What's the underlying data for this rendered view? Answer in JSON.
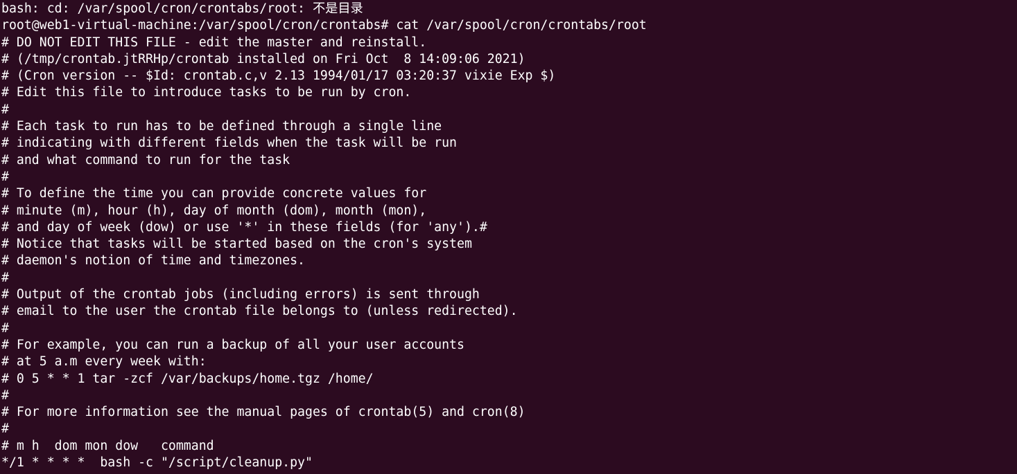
{
  "terminal": {
    "colors": {
      "background": "#2c0b20",
      "text": "#ffffff"
    },
    "lines": [
      "bash: cd: /var/spool/cron/crontabs/root: 不是目录",
      "root@web1-virtual-machine:/var/spool/cron/crontabs# cat /var/spool/cron/crontabs/root",
      "# DO NOT EDIT THIS FILE - edit the master and reinstall.",
      "# (/tmp/crontab.jtRRHp/crontab installed on Fri Oct  8 14:09:06 2021)",
      "# (Cron version -- $Id: crontab.c,v 2.13 1994/01/17 03:20:37 vixie Exp $)",
      "# Edit this file to introduce tasks to be run by cron.",
      "#",
      "# Each task to run has to be defined through a single line",
      "# indicating with different fields when the task will be run",
      "# and what command to run for the task",
      "#",
      "# To define the time you can provide concrete values for",
      "# minute (m), hour (h), day of month (dom), month (mon),",
      "# and day of week (dow) or use '*' in these fields (for 'any').#",
      "# Notice that tasks will be started based on the cron's system",
      "# daemon's notion of time and timezones.",
      "#",
      "# Output of the crontab jobs (including errors) is sent through",
      "# email to the user the crontab file belongs to (unless redirected).",
      "#",
      "# For example, you can run a backup of all your user accounts",
      "# at 5 a.m every week with:",
      "# 0 5 * * 1 tar -zcf /var/backups/home.tgz /home/",
      "#",
      "# For more information see the manual pages of crontab(5) and cron(8)",
      "#",
      "# m h  dom mon dow   command",
      "*/1 * * * *  bash -c \"/script/cleanup.py\""
    ]
  }
}
